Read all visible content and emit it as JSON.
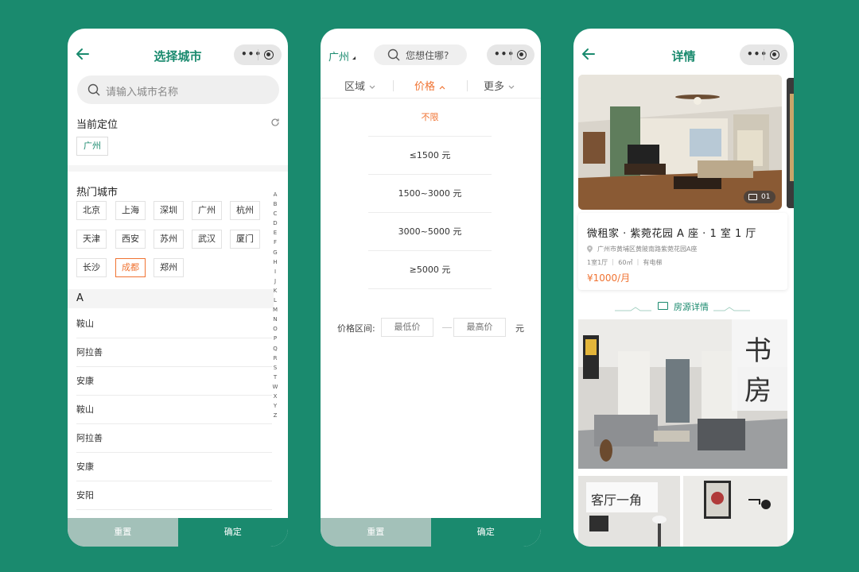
{
  "colors": {
    "brand": "#1a8a6e",
    "accent": "#f07332",
    "background": "#1a8a6e"
  },
  "screen1": {
    "title": "选择城市",
    "search_placeholder": "请输入城市名称",
    "current_location_label": "当前定位",
    "current_city": "广州",
    "hot_cities_label": "热门城市",
    "hot_cities": [
      "北京",
      "上海",
      "深圳",
      "广州",
      "杭州",
      "天津",
      "西安",
      "苏州",
      "武汉",
      "厦门",
      "长沙",
      "成都",
      "郑州"
    ],
    "selected_hot_city": "成都",
    "letter_header": "A",
    "cities": [
      "鞍山",
      "阿拉善",
      "安康",
      "鞍山",
      "阿拉善",
      "安康",
      "安阳"
    ],
    "alphabet": [
      "A",
      "B",
      "C",
      "D",
      "E",
      "F",
      "G",
      "H",
      "I",
      "J",
      "K",
      "L",
      "M",
      "N",
      "O",
      "P",
      "Q",
      "R",
      "S",
      "T",
      "W",
      "X",
      "Y",
      "Z"
    ],
    "reset_label": "重置",
    "confirm_label": "确定"
  },
  "screen2": {
    "city": "广州",
    "search_placeholder": "您想住哪?",
    "tabs": [
      {
        "label": "区域",
        "active": false
      },
      {
        "label": "价格",
        "active": true
      },
      {
        "label": "更多",
        "active": false
      }
    ],
    "price_options": [
      "不限",
      "≤1500 元",
      "1500~3000 元",
      "3000~5000 元",
      "≥5000 元"
    ],
    "selected_option": "不限",
    "range_label": "价格区间:",
    "min_placeholder": "最低价",
    "max_placeholder": "最高价",
    "range_unit": "元",
    "reset_label": "重置",
    "confirm_label": "确定"
  },
  "screen3": {
    "title": "详情",
    "photo_counter": "01",
    "listing_title": "微租家 · 紫菀花园 A 座 · 1 室 1 厅",
    "address": "广州市黄埔区黄陂南路紫菀花园A座",
    "meta": "1室1厅 ｜ 60㎡ ｜ 有电梯",
    "price": "¥1000/月",
    "section_label": "房源详情",
    "room1_caption": [
      "书",
      "房"
    ],
    "room2_caption": "客厅一角"
  }
}
